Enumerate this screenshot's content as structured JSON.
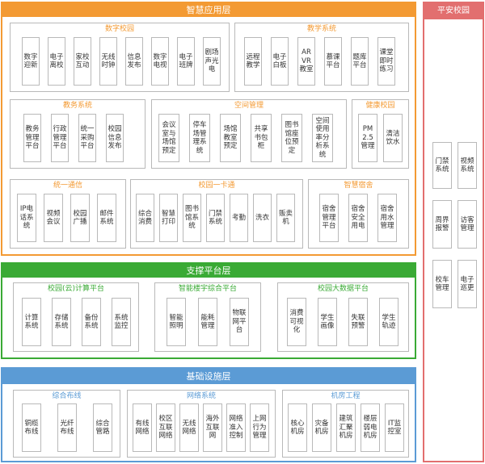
{
  "colors": {
    "orange": "#f39a33",
    "green": "#3aaa35",
    "blue": "#5b9bd5",
    "red": "#e26f6f"
  },
  "layers": [
    {
      "title": "智慧应用层",
      "color": "#f39a33",
      "box": {},
      "groups": [
        {
          "title": "数字校园",
          "items": [
            "数字迎新",
            "电子离校",
            "家校互动",
            "无线时钟",
            "信息发布",
            "数字电视",
            "电子班牌",
            "剧场声光电"
          ]
        },
        {
          "title": "教学系统",
          "items": [
            "远程教学",
            "电子白板",
            "AR VR教室",
            "慕课平台",
            "题库平台",
            "课堂即时练习"
          ]
        },
        {
          "title": "教务系统",
          "items": [
            "教务管理平台",
            "行政管理平台",
            "统一采购平台",
            "校园信息发布"
          ]
        },
        {
          "title": "空间管理",
          "items": [
            "会议室与场馆预定",
            "停车场管理系统",
            "场馆教室预定",
            "共享书包柜",
            "图书馆座位预定",
            "空间使用率分析系统"
          ]
        },
        {
          "title": "健康校园",
          "items": [
            "PM 2.5管理",
            "清洁饮水"
          ]
        },
        {
          "title": "统一通信",
          "items": [
            "IP电话系统",
            "视频会议",
            "校园广播",
            "邮件系统"
          ]
        },
        {
          "title": "校园一卡通",
          "items": [
            "综合消费",
            "智慧打印",
            "图书馆系统",
            "门禁系统",
            "考勤",
            "洗衣",
            "贩卖机"
          ]
        },
        {
          "title": "智慧宿舍",
          "items": [
            "宿舍管理平台",
            "宿舍安全用电",
            "宿舍用水管理"
          ]
        }
      ]
    },
    {
      "title": "支撑平台层",
      "color": "#3aaa35",
      "groups": [
        {
          "title": "校园(云)计算平台",
          "items": [
            "计算系统",
            "存储系统",
            "备份系统",
            "系统监控"
          ]
        },
        {
          "title": "智能楼宇综合平台",
          "items": [
            "智能照明",
            "能耗管理",
            "物联网平台"
          ]
        },
        {
          "title": "校园大数据平台",
          "items": [
            "消费可视化",
            "学生画像",
            "失联预警",
            "学生轨迹"
          ]
        }
      ]
    },
    {
      "title": "基础设施层",
      "color": "#5b9bd5",
      "groups": [
        {
          "title": "综合布线",
          "items": [
            "铜缆布线",
            "光纤布线",
            "综合管路"
          ]
        },
        {
          "title": "网络系统",
          "items": [
            "有线网络",
            "校区互联网络",
            "无线网络",
            "海外互联网",
            "网络准入控制",
            "上网行为管理"
          ]
        },
        {
          "title": "机房工程",
          "items": [
            "核心机房",
            "灾备机房",
            "建筑汇聚机房",
            "楼层弱电机房",
            "IT监控室"
          ]
        }
      ]
    }
  ],
  "safe": {
    "title": "平安校园",
    "color": "#e26f6f",
    "items": [
      "门禁系统",
      "视频系统",
      "周界报警",
      "访客管理",
      "校车管理",
      "电子巡更"
    ]
  }
}
